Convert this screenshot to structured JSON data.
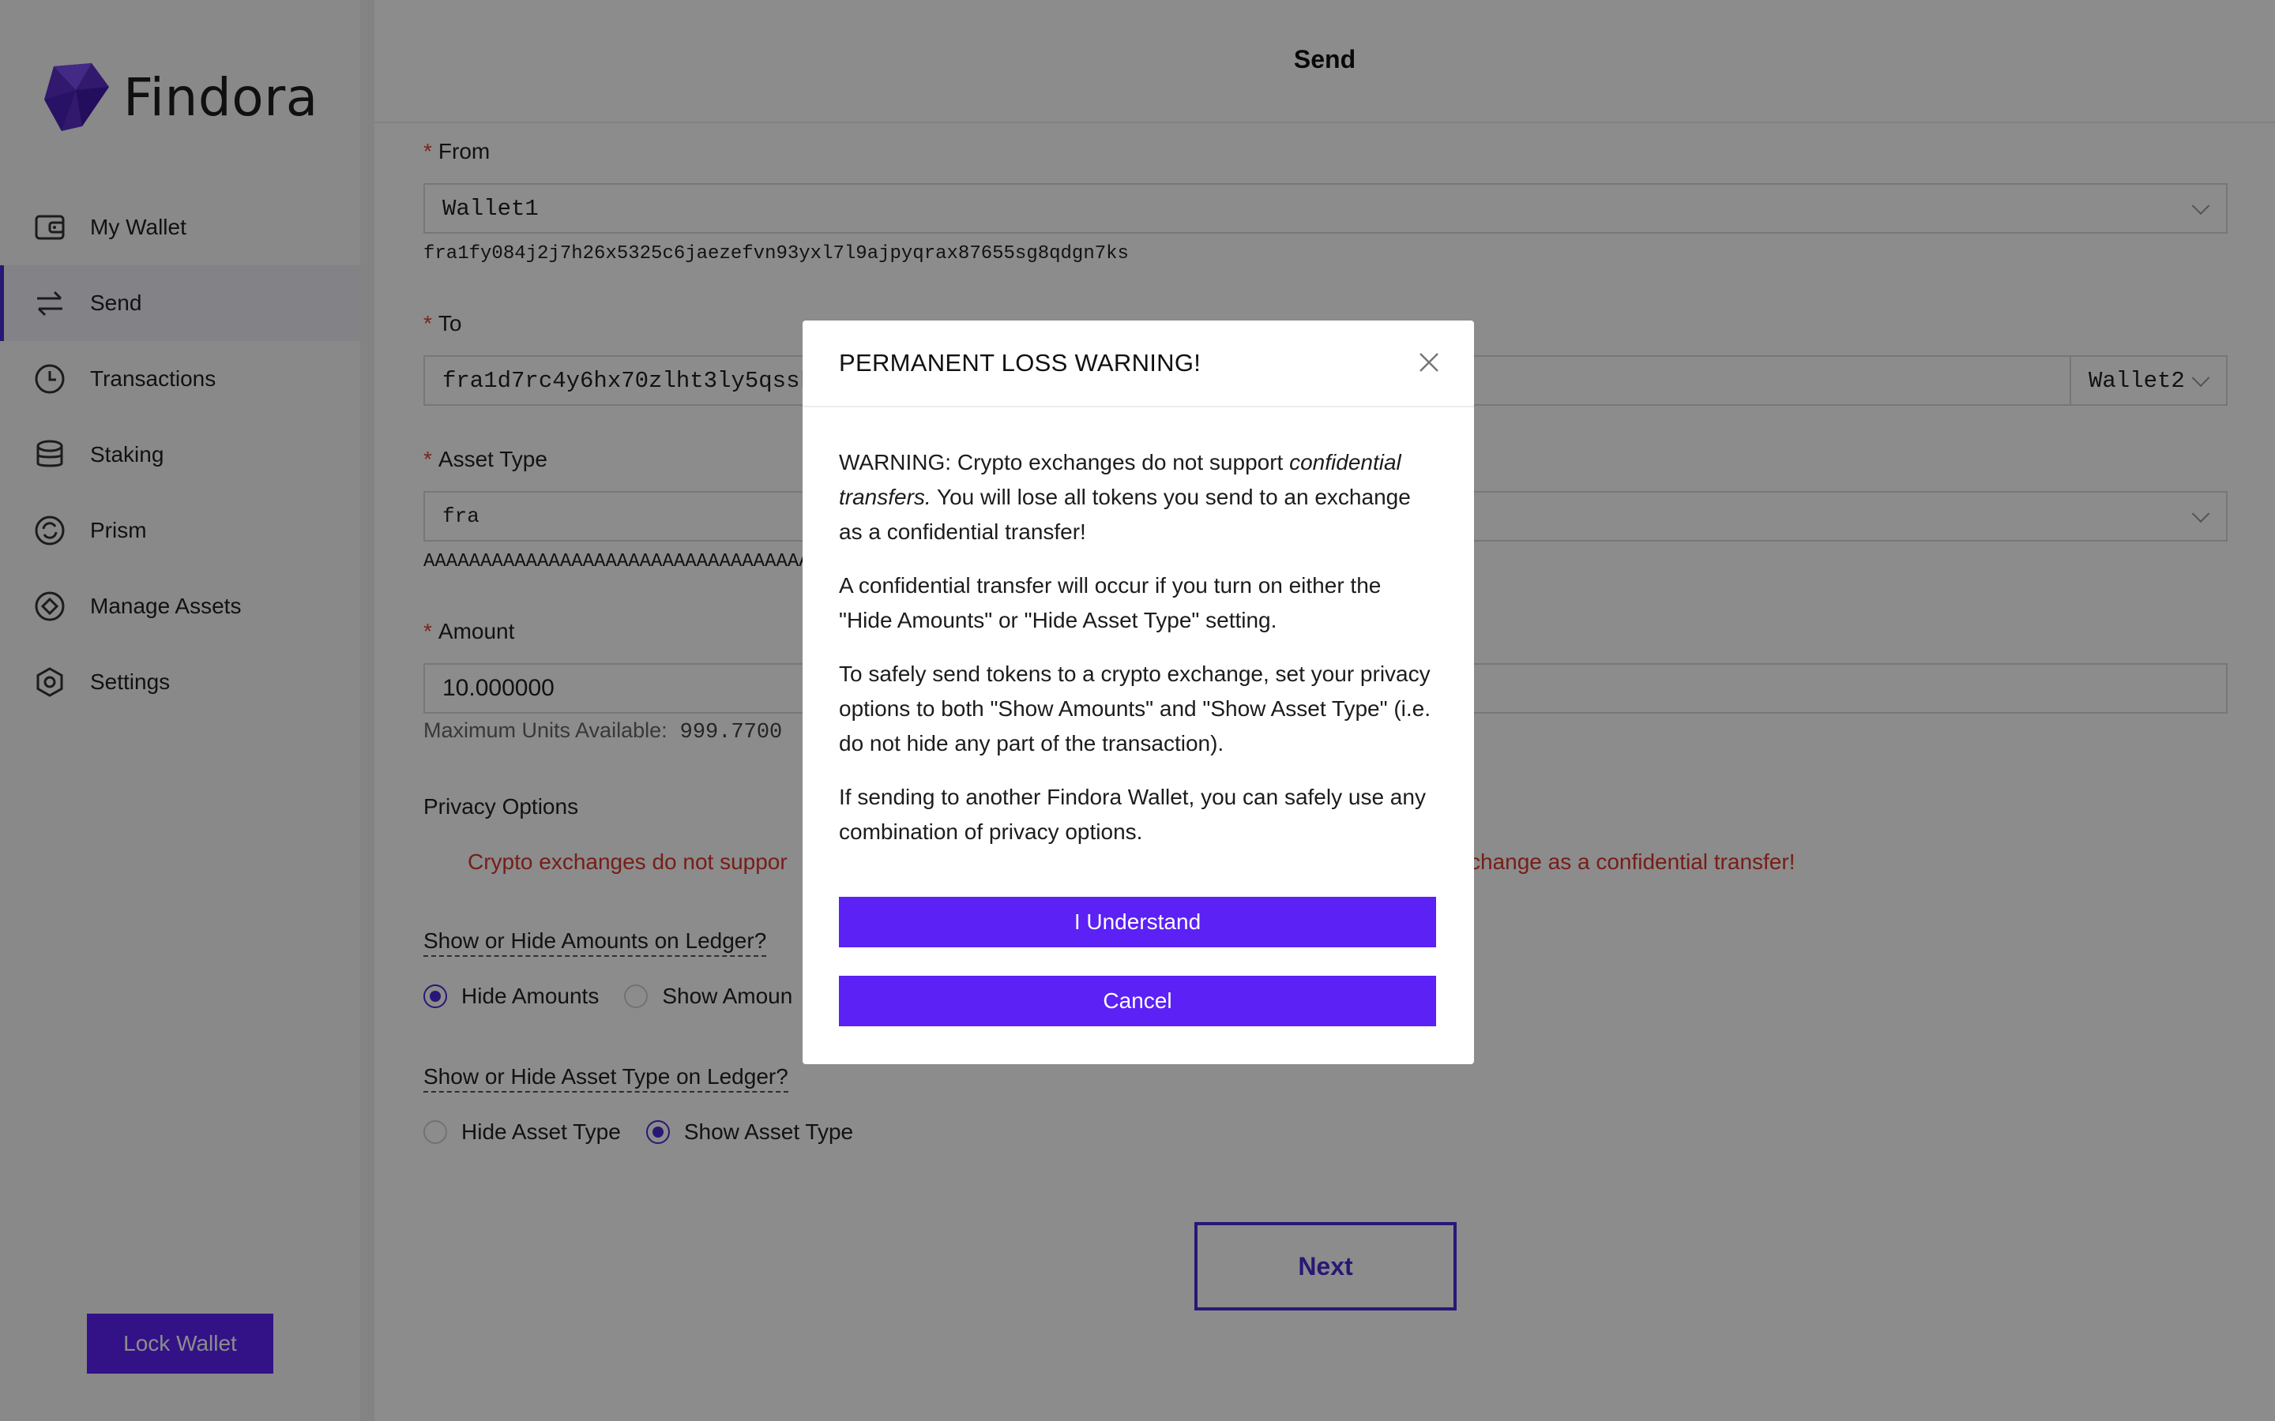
{
  "app": {
    "brand": "Findora"
  },
  "sidebar": {
    "items": [
      {
        "label": "My Wallet",
        "icon": "wallet-icon"
      },
      {
        "label": "Send",
        "icon": "transfer-arrows-icon",
        "active": true
      },
      {
        "label": "Transactions",
        "icon": "clock-icon"
      },
      {
        "label": "Staking",
        "icon": "database-stack-icon"
      },
      {
        "label": "Prism",
        "icon": "refresh-circle-icon"
      },
      {
        "label": "Manage Assets",
        "icon": "diamond-circle-icon"
      },
      {
        "label": "Settings",
        "icon": "hexagon-gear-icon"
      }
    ],
    "lock_label": "Lock Wallet"
  },
  "page": {
    "title": "Send"
  },
  "form": {
    "from": {
      "label": "From",
      "value": "Wallet1",
      "address": "fra1fy084j2j7h26x5325c6jaezefvn93yxl7l9ajpyqrax87655sg8qdgn7ks"
    },
    "to": {
      "label": "To",
      "value": "fra1d7rc4y6hx70zlht3ly5qssk",
      "wallet_select": "Wallet2"
    },
    "asset_type": {
      "label": "Asset Type",
      "value": "fra",
      "code": "AAAAAAAAAAAAAAAAAAAAAAAAAAAAAAAAAAAAAAAAAAAA"
    },
    "amount": {
      "label": "Amount",
      "value": "10.000000",
      "max_label": "Maximum Units Available:",
      "max_value": "999.7700"
    },
    "privacy": {
      "title": "Privacy Options",
      "warning_left": "Crypto exchanges do not suppor",
      "warning_right": "change as a confidential transfer!",
      "amounts_question": "Show or Hide Amounts on Ledger?",
      "hide_amounts": "Hide Amounts",
      "show_amounts": "Show Amoun",
      "asset_question": "Show or Hide Asset Type on Ledger?",
      "hide_asset": "Hide Asset Type",
      "show_asset": "Show Asset Type"
    },
    "next_label": "Next"
  },
  "modal": {
    "title": "PERMANENT LOSS WARNING!",
    "p1_prefix": "WARNING: Crypto exchanges do not support ",
    "p1_em": "confidential transfers.",
    "p1_suffix": " You will lose all tokens you send to an exchange as a confidential transfer!",
    "p2": "A confidential transfer will occur if you turn on either the \"Hide Amounts\" or \"Hide Asset Type\" setting.",
    "p3": "To safely send tokens to a crypto exchange, set your privacy options to both \"Show Amounts\" and \"Show Asset Type\" (i.e. do not hide any part of the transaction).",
    "p4": "If sending to another Findora Wallet, you can safely use any combination of privacy options.",
    "understand_label": "I Understand",
    "cancel_label": "Cancel"
  },
  "colors": {
    "accent": "#5b21f5",
    "active_indicator": "#4c2ad6",
    "warning_text": "#d8372d"
  }
}
